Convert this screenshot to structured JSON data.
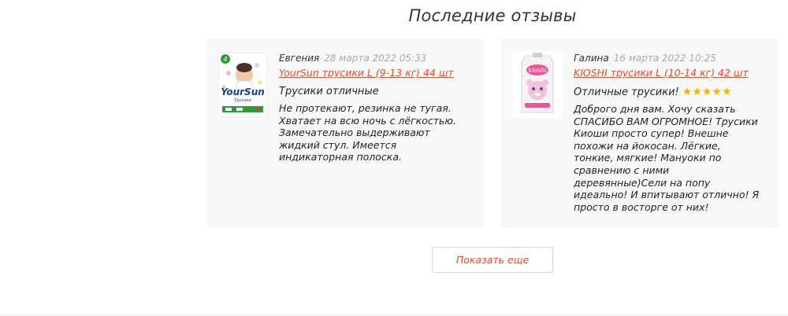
{
  "section": {
    "title": "Последние отзывы"
  },
  "reviews": [
    {
      "author": "Евгения",
      "date": "28 марта 2022 05:33",
      "product": "YourSun трусики L (9-13 кг) 44 шт",
      "title": "Трусики отличные",
      "stars": "",
      "text": "Не протекают, резинка не тугая. Хватает на всю ночь с лёгкостью. Замечательно выдерживают жидкий стул. Имеется индикаторная полоска.",
      "thumb_icon": "yoursun-diaper-pack-image",
      "thumb_text": "YourSun",
      "thumb_size": "4",
      "thumb_caption": "Трусики"
    },
    {
      "author": "Галина",
      "date": "16 марта 2022 10:25",
      "product": "KIOSHI трусики L (10-14 кг) 42 шт",
      "title": "Отличные трусики!",
      "stars": "★★★★★",
      "rating": 5,
      "text": "Доброго дня вам. Хочу сказать СПАСИБО ВАМ ОГРОМНОЕ! Трусики Киоши просто супер! Внешне похожи на йокосан. Лёгкие, тонкие, мягкие! Мануоки по сравнению с ними деревянные)Сели на попу идеально! И впитывают отлично! Я просто в восторге от них!",
      "thumb_icon": "kioshi-diaper-pack-image",
      "thumb_text": "kioshi"
    }
  ],
  "more_button": {
    "label": "Показать еще"
  },
  "colors": {
    "accent": "#e44d2e",
    "star": "#f5b400",
    "card_bg": "#f8f8f8"
  }
}
